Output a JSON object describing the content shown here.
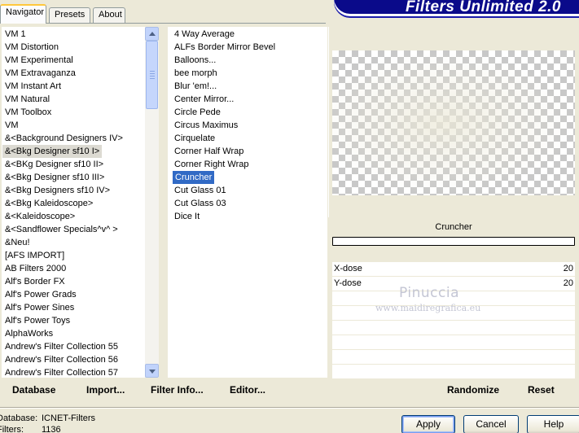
{
  "tabs": [
    {
      "label": "Navigator"
    },
    {
      "label": "Presets"
    },
    {
      "label": "About"
    }
  ],
  "app_title": "Filters Unlimited 2.0",
  "categories": [
    "VM 1",
    "VM Distortion",
    "VM Experimental",
    "VM Extravaganza",
    "VM Instant Art",
    "VM Natural",
    "VM Toolbox",
    "VM",
    "&<Background Designers IV>",
    "&<Bkg Designer sf10 I>",
    "&<BKg Designer sf10 II>",
    "&<Bkg Designer sf10 III>",
    "&<Bkg Designers sf10 IV>",
    "&<Bkg Kaleidoscope>",
    "&<Kaleidoscope>",
    "&<Sandflower Specials^v^ >",
    "&Neu!",
    "[AFS IMPORT]",
    "AB Filters 2000",
    "Alf's Border FX",
    "Alf's Power Grads",
    "Alf's Power Sines",
    "Alf's Power Toys",
    "AlphaWorks",
    "Andrew's Filter Collection 55",
    "Andrew's Filter Collection 56",
    "Andrew's Filter Collection 57"
  ],
  "selected_category": "&<Bkg Designer sf10 I>",
  "filters": [
    "4 Way Average",
    "ALFs Border Mirror Bevel",
    "Balloons...",
    "bee morph",
    "Blur 'em!...",
    "Center Mirror...",
    "Circle Pede",
    "Circus Maximus",
    "Cirquelate",
    "Corner Half Wrap",
    "Corner Right Wrap",
    "Cruncher",
    "Cut Glass 01",
    "Cut Glass 03",
    "Dice It"
  ],
  "selected_filter": "Cruncher",
  "filter_name": "Cruncher",
  "params": [
    {
      "label": "X-dose",
      "value": "20"
    },
    {
      "label": "Y-dose",
      "value": "20"
    }
  ],
  "watermark": {
    "line1": "Pinuccia",
    "line2": "www.maidiregrafica.eu"
  },
  "left_buttons": {
    "database": "Database",
    "import": "Import...",
    "filter_info": "Filter Info...",
    "editor": "Editor..."
  },
  "right_buttons": {
    "randomize": "Randomize",
    "reset": "Reset"
  },
  "status": {
    "database_label": "Database:",
    "database_value": "ICNET-Filters",
    "filters_label": "Filters:",
    "filters_value": "1136"
  },
  "dialog_buttons": {
    "apply": "Apply",
    "cancel": "Cancel",
    "help": "Help"
  },
  "colors": {
    "selection": "#316ac5",
    "banner": "#0a0a8a",
    "face": "#ece9d8"
  }
}
